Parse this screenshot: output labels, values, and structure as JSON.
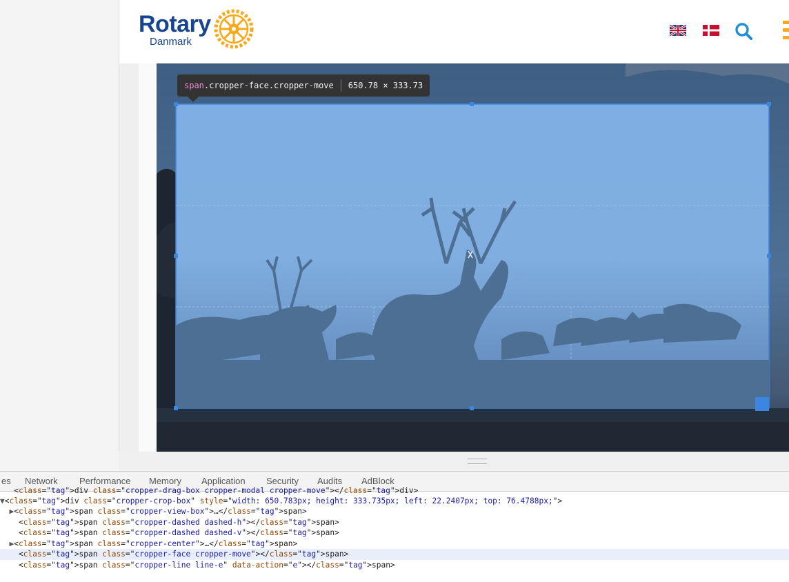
{
  "site": {
    "logo_word": "Rotary",
    "logo_sub": "Danmark",
    "header_icons": [
      "uk-flag-icon",
      "danish-flag-icon",
      "search-icon",
      "menu-icon"
    ],
    "brand_color": "#17458f",
    "gold_color": "#f7a81b"
  },
  "inspector_tooltip": {
    "selector_tag": "span",
    "selector_classes": ".cropper-face.cropper-move",
    "dimensions": "650.78 × 333.73"
  },
  "devtools": {
    "tabs": [
      "es",
      "Network",
      "Performance",
      "Memory",
      "Application",
      "Security",
      "Audits",
      "AdBlock"
    ],
    "dom_lines": [
      {
        "indent": "  ",
        "marker": "",
        "text": "<div class=\"cropper-drag-box cropper-modal cropper-move\"></div>"
      },
      {
        "indent": "",
        "marker": "▼",
        "text": "<div class=\"cropper-crop-box\" style=\"width: 650.783px; height: 333.735px; left: 22.2407px; top: 76.4788px;\">"
      },
      {
        "indent": "  ",
        "marker": "▶",
        "text": "<span class=\"cropper-view-box\">…</span>"
      },
      {
        "indent": "   ",
        "marker": "",
        "text": "<span class=\"cropper-dashed dashed-h\"></span>"
      },
      {
        "indent": "   ",
        "marker": "",
        "text": "<span class=\"cropper-dashed dashed-v\"></span>"
      },
      {
        "indent": "  ",
        "marker": "▶",
        "text": "<span class=\"cropper-center\">…</span>"
      },
      {
        "indent": "   ",
        "marker": "",
        "text": "<span class=\"cropper-face cropper-move\"></span>"
      },
      {
        "indent": "   ",
        "marker": "",
        "text": "<span class=\"cropper-line line-e\" data-action=\"e\"></span>"
      }
    ],
    "selected_line": 6
  }
}
